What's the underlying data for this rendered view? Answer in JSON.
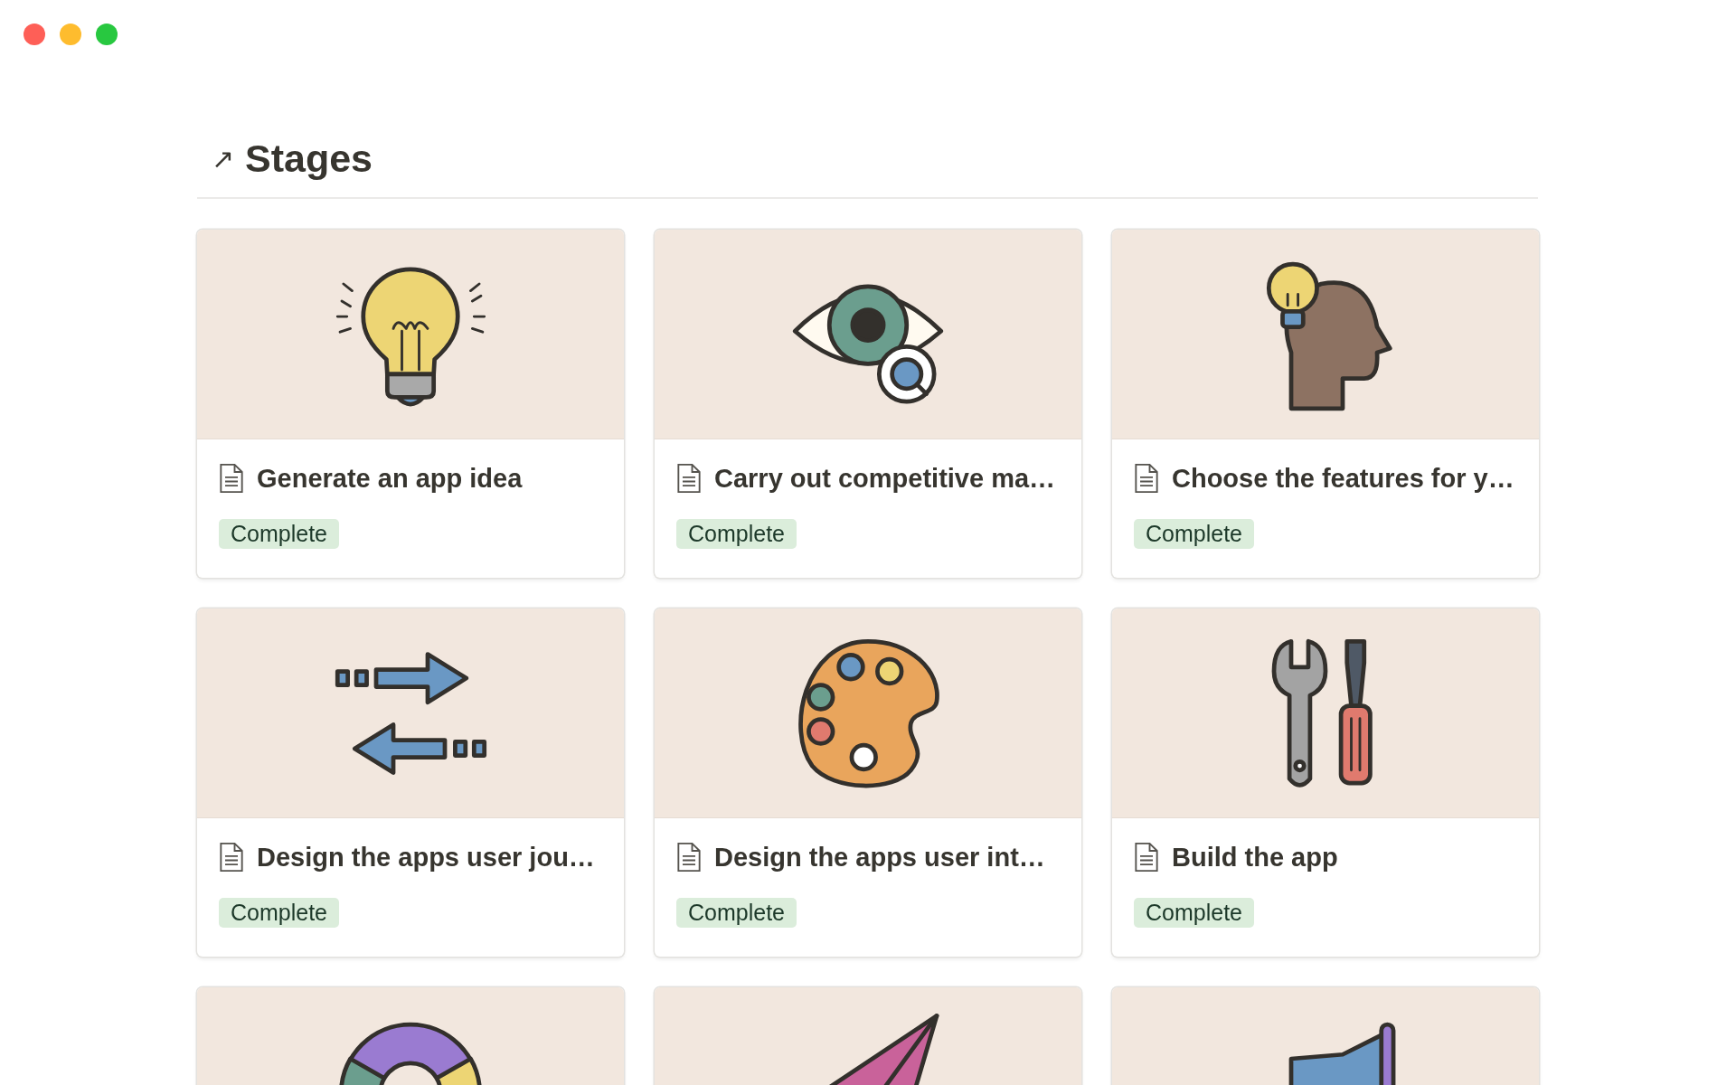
{
  "heading": {
    "arrow": "↗",
    "title": "Stages"
  },
  "cards": [
    {
      "kind": "page",
      "title": "Generate an app idea",
      "status": "Complete"
    },
    {
      "kind": "page",
      "title": "Carry out competitive ma…",
      "status": "Complete"
    },
    {
      "kind": "page",
      "title": "Choose the features for y…",
      "status": "Complete"
    },
    {
      "kind": "page",
      "title": "Design the apps user jou…",
      "status": "Complete"
    },
    {
      "kind": "page",
      "title": "Design the apps user int…",
      "status": "Complete"
    },
    {
      "kind": "page",
      "title": "Build the app",
      "status": "Complete"
    },
    {
      "kind": "cover"
    },
    {
      "kind": "cover"
    },
    {
      "kind": "cover"
    }
  ]
}
